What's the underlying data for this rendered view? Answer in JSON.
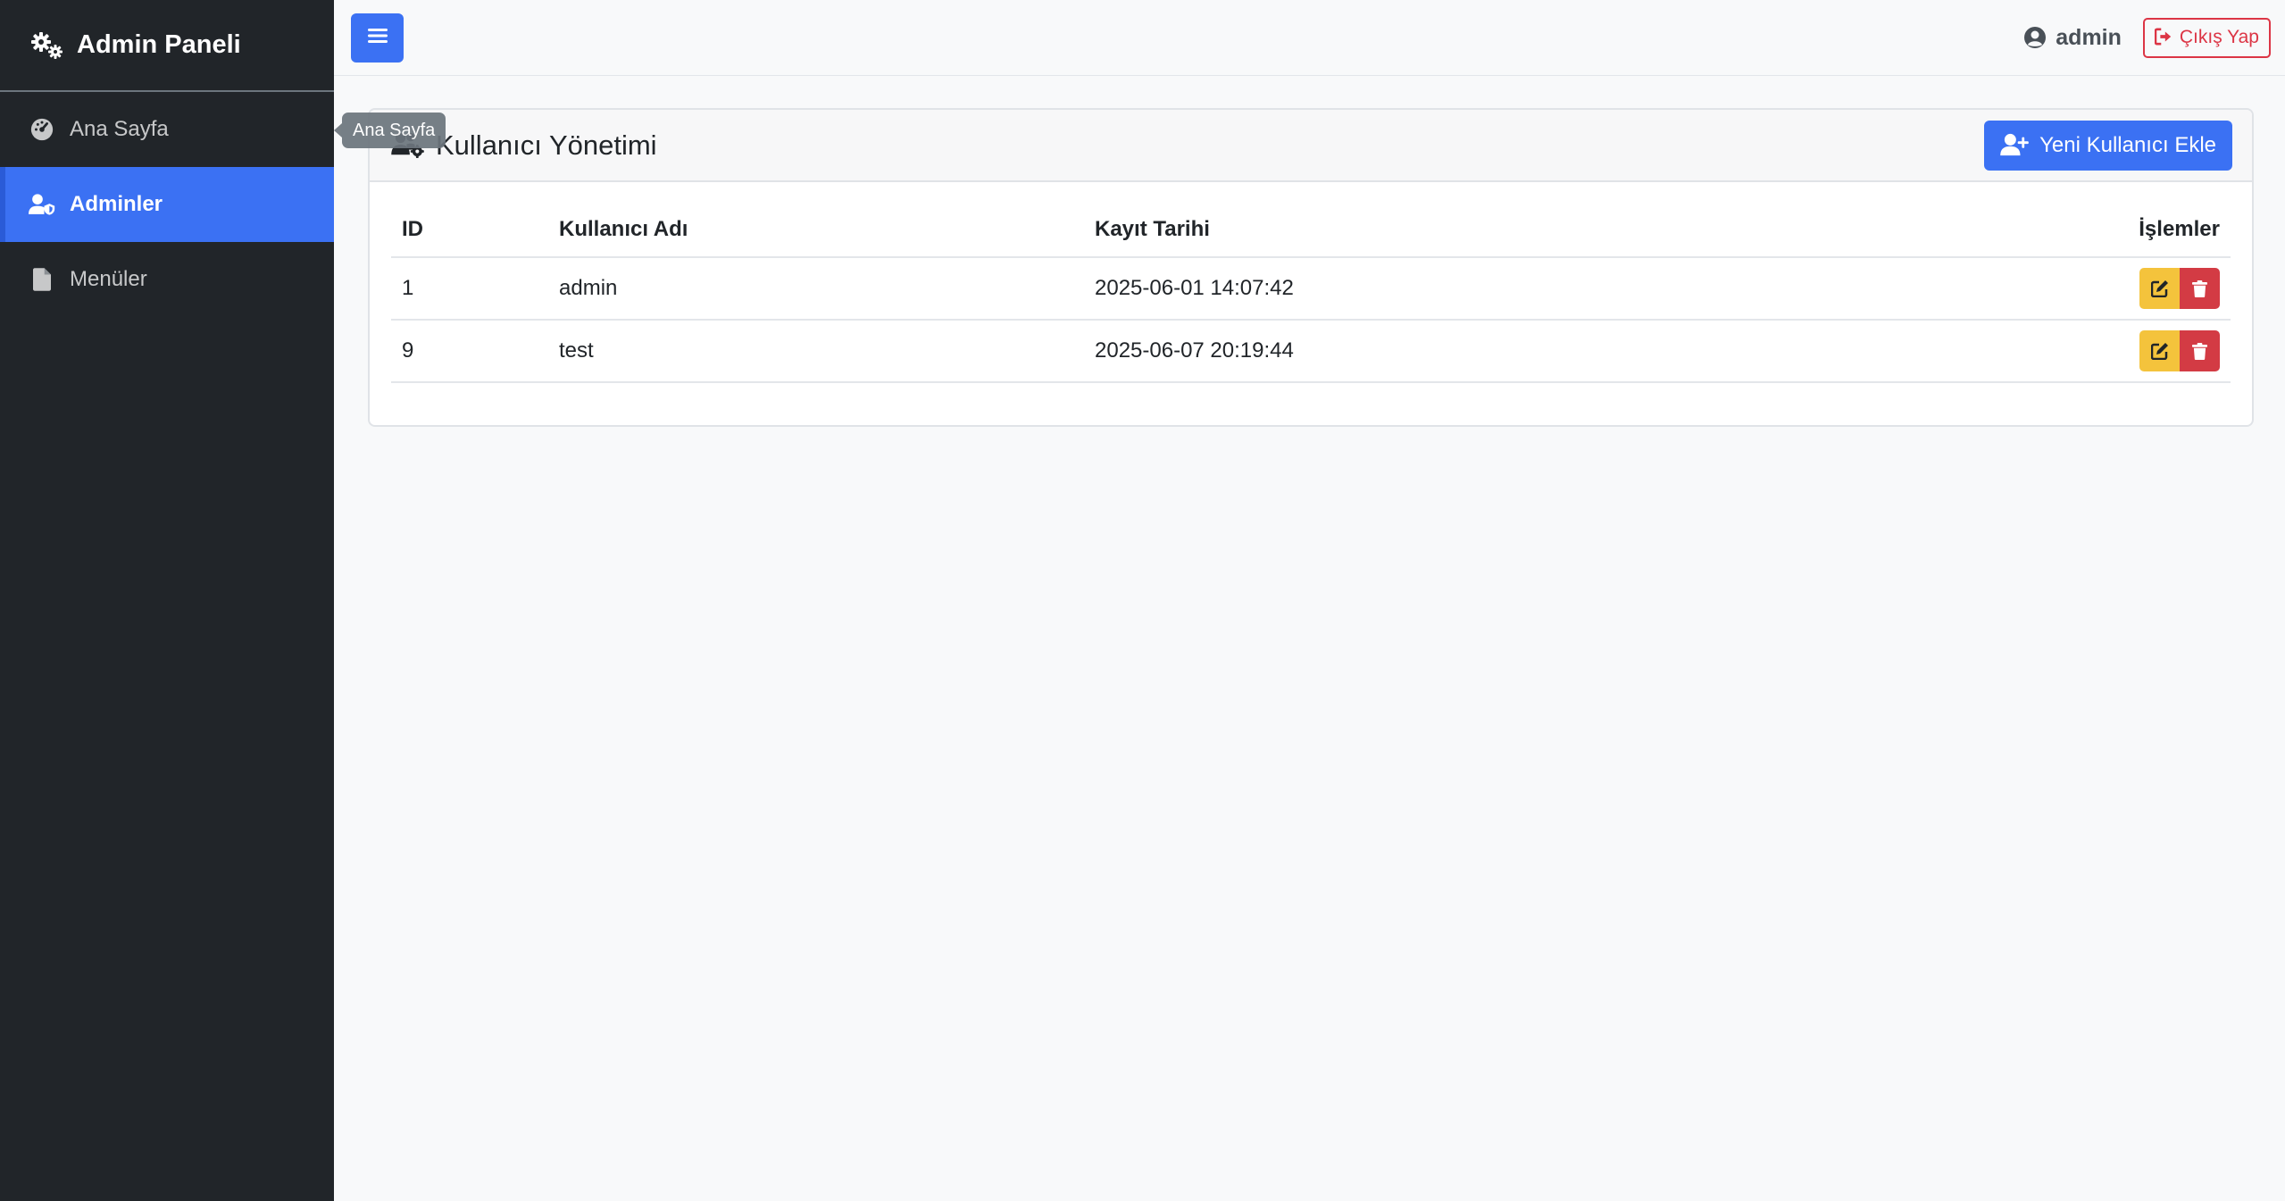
{
  "sidebar": {
    "brand": "Admin Paneli",
    "items": [
      {
        "label": "Ana Sayfa",
        "icon": "dashboard-icon",
        "active": false
      },
      {
        "label": "Adminler",
        "icon": "user-shield-icon",
        "active": true
      },
      {
        "label": "Menüler",
        "icon": "file-icon",
        "active": false
      }
    ]
  },
  "tooltip": {
    "text": "Ana Sayfa"
  },
  "topbar": {
    "user": "admin",
    "logout_label": "Çıkış Yap"
  },
  "card": {
    "title": "Kullanıcı Yönetimi",
    "add_label": "Yeni Kullanıcı Ekle"
  },
  "table": {
    "headers": [
      "ID",
      "Kullanıcı Adı",
      "Kayıt Tarihi",
      "İşlemler"
    ],
    "rows": [
      {
        "id": "1",
        "username": "admin",
        "date": "2025-06-01 14:07:42"
      },
      {
        "id": "9",
        "username": "test",
        "date": "2025-06-07 20:19:44"
      }
    ]
  },
  "colors": {
    "sidebar_bg": "#212529",
    "primary": "#3b71f3",
    "warning": "#f4c33c",
    "danger": "#d33b44"
  }
}
